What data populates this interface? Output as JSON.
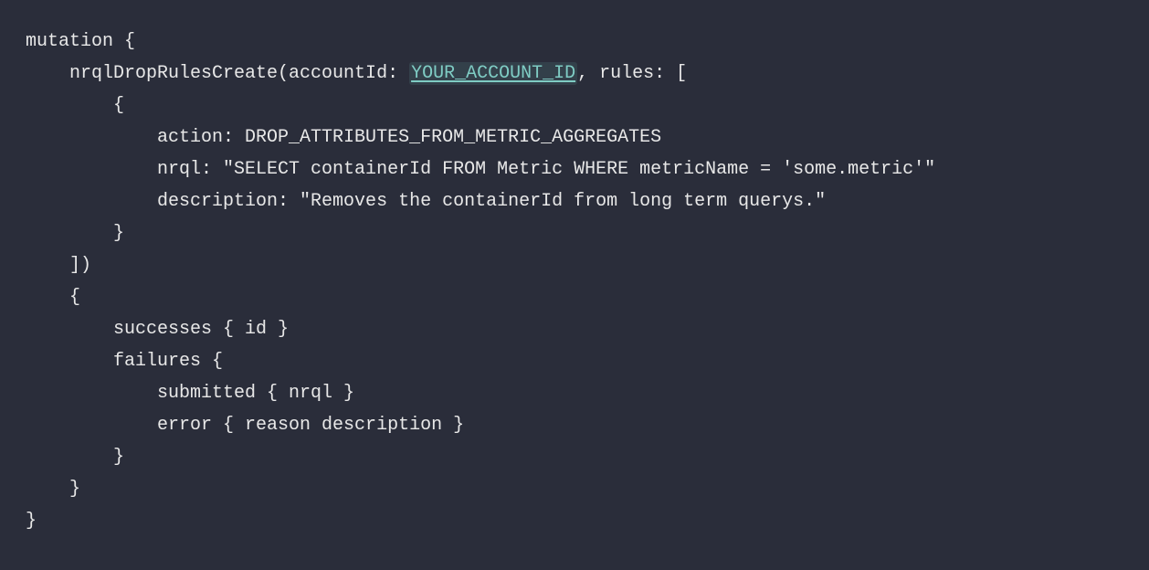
{
  "code": {
    "line1": "mutation {",
    "line2_pre": "    nrqlDropRulesCreate(accountId: ",
    "line2_placeholder": "YOUR_ACCOUNT_ID",
    "line2_post": ", rules: [",
    "line3": "        {",
    "line4": "            action: DROP_ATTRIBUTES_FROM_METRIC_AGGREGATES",
    "line5": "            nrql: \"SELECT containerId FROM Metric WHERE metricName = 'some.metric'\"",
    "line6": "            description: \"Removes the containerId from long term querys.\"",
    "line7": "        }",
    "line8": "    ])",
    "line9": "    {",
    "line10": "        successes { id }",
    "line11": "        failures {",
    "line12": "            submitted { nrql }",
    "line13": "            error { reason description }",
    "line14": "        }",
    "line15": "    }",
    "line16": "}"
  }
}
